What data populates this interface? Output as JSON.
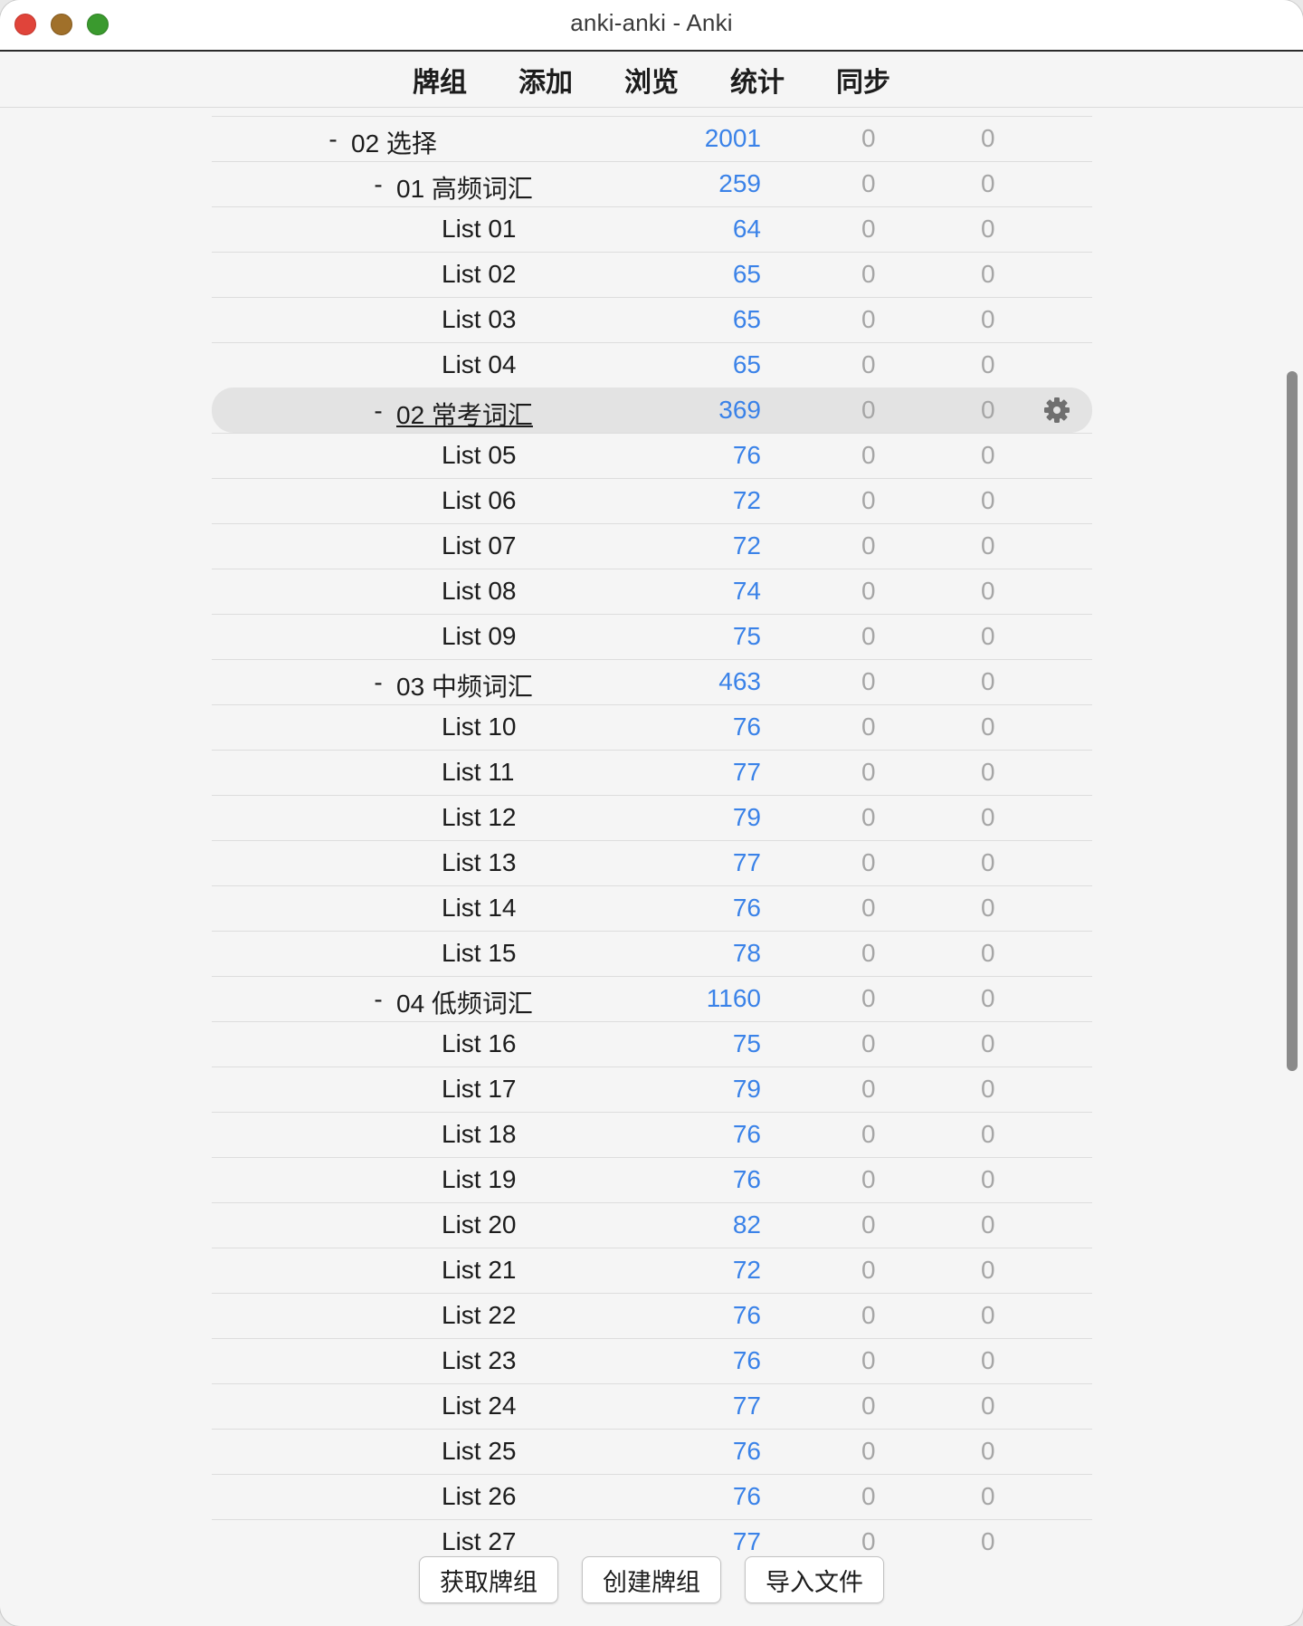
{
  "window": {
    "title": "anki-anki - Anki"
  },
  "toolbar": {
    "items": [
      "牌组",
      "添加",
      "浏览",
      "统计",
      "同步"
    ]
  },
  "decks": [
    {
      "name": "02 选择",
      "level": 0,
      "collapse": "-",
      "new": "2001",
      "learn": "0",
      "review": "0"
    },
    {
      "name": "01 高频词汇",
      "level": 1,
      "collapse": "-",
      "new": "259",
      "learn": "0",
      "review": "0"
    },
    {
      "name": "List 01",
      "level": 2,
      "new": "64",
      "learn": "0",
      "review": "0"
    },
    {
      "name": "List 02",
      "level": 2,
      "new": "65",
      "learn": "0",
      "review": "0"
    },
    {
      "name": "List 03",
      "level": 2,
      "new": "65",
      "learn": "0",
      "review": "0"
    },
    {
      "name": "List 04",
      "level": 2,
      "new": "65",
      "learn": "0",
      "review": "0"
    },
    {
      "name": "02 常考词汇",
      "level": 1,
      "collapse": "-",
      "new": "369",
      "learn": "0",
      "review": "0",
      "current": true
    },
    {
      "name": "List 05",
      "level": 2,
      "new": "76",
      "learn": "0",
      "review": "0"
    },
    {
      "name": "List 06",
      "level": 2,
      "new": "72",
      "learn": "0",
      "review": "0"
    },
    {
      "name": "List 07",
      "level": 2,
      "new": "72",
      "learn": "0",
      "review": "0"
    },
    {
      "name": "List 08",
      "level": 2,
      "new": "74",
      "learn": "0",
      "review": "0"
    },
    {
      "name": "List 09",
      "level": 2,
      "new": "75",
      "learn": "0",
      "review": "0"
    },
    {
      "name": "03 中频词汇",
      "level": 1,
      "collapse": "-",
      "new": "463",
      "learn": "0",
      "review": "0"
    },
    {
      "name": "List 10",
      "level": 2,
      "new": "76",
      "learn": "0",
      "review": "0"
    },
    {
      "name": "List 11",
      "level": 2,
      "new": "77",
      "learn": "0",
      "review": "0"
    },
    {
      "name": "List 12",
      "level": 2,
      "new": "79",
      "learn": "0",
      "review": "0"
    },
    {
      "name": "List 13",
      "level": 2,
      "new": "77",
      "learn": "0",
      "review": "0"
    },
    {
      "name": "List 14",
      "level": 2,
      "new": "76",
      "learn": "0",
      "review": "0"
    },
    {
      "name": "List 15",
      "level": 2,
      "new": "78",
      "learn": "0",
      "review": "0"
    },
    {
      "name": "04 低频词汇",
      "level": 1,
      "collapse": "-",
      "new": "1160",
      "learn": "0",
      "review": "0"
    },
    {
      "name": "List 16",
      "level": 2,
      "new": "75",
      "learn": "0",
      "review": "0"
    },
    {
      "name": "List 17",
      "level": 2,
      "new": "79",
      "learn": "0",
      "review": "0"
    },
    {
      "name": "List 18",
      "level": 2,
      "new": "76",
      "learn": "0",
      "review": "0"
    },
    {
      "name": "List 19",
      "level": 2,
      "new": "76",
      "learn": "0",
      "review": "0"
    },
    {
      "name": "List 20",
      "level": 2,
      "new": "82",
      "learn": "0",
      "review": "0"
    },
    {
      "name": "List 21",
      "level": 2,
      "new": "72",
      "learn": "0",
      "review": "0"
    },
    {
      "name": "List 22",
      "level": 2,
      "new": "76",
      "learn": "0",
      "review": "0"
    },
    {
      "name": "List 23",
      "level": 2,
      "new": "76",
      "learn": "0",
      "review": "0"
    },
    {
      "name": "List 24",
      "level": 2,
      "new": "77",
      "learn": "0",
      "review": "0"
    },
    {
      "name": "List 25",
      "level": 2,
      "new": "76",
      "learn": "0",
      "review": "0"
    },
    {
      "name": "List 26",
      "level": 2,
      "new": "76",
      "learn": "0",
      "review": "0"
    },
    {
      "name": "List 27",
      "level": 2,
      "new": "77",
      "learn": "0",
      "review": "0"
    }
  ],
  "current_deck_options_icon": "gear-icon",
  "footer": {
    "buttons": [
      "获取牌组",
      "创建牌组",
      "导入文件"
    ]
  },
  "colors": {
    "new_count": "#3a82e8",
    "zero_count": "#a6a6a6",
    "close": "#e0443a",
    "minimize": "#a0702a",
    "zoom": "#3a9a2e"
  }
}
